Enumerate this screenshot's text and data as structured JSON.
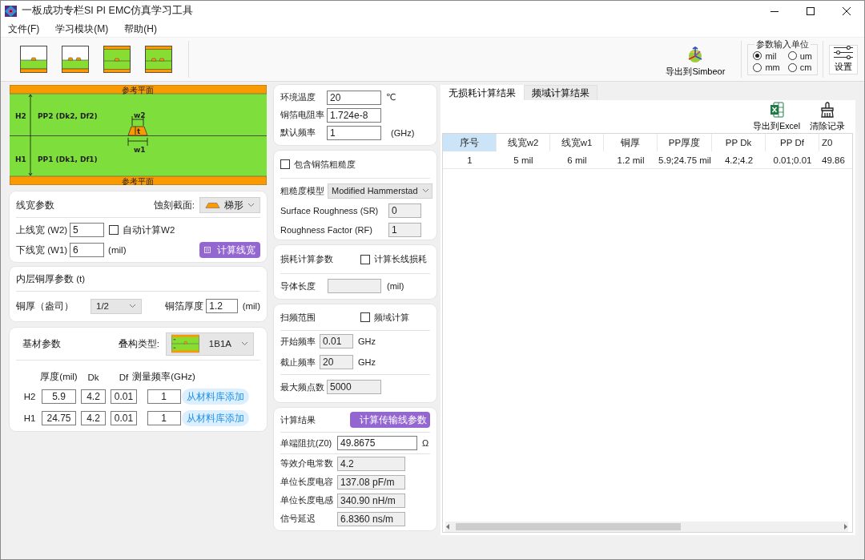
{
  "window": {
    "title": "一板成功专栏SI PI EMC仿真学习工具"
  },
  "menu": [
    "文件(F)",
    "学习模块(M)",
    "帮助(H)"
  ],
  "toolbar": {
    "stackups": [
      {
        "kind": "microstrip1"
      },
      {
        "kind": "microstrip2"
      },
      {
        "kind": "stripline1"
      },
      {
        "kind": "stripline2"
      }
    ],
    "export_simbeor": "导出到Simbeor",
    "units": {
      "title": "参数输入单位",
      "options": [
        {
          "label": "mil",
          "selected": true
        },
        {
          "label": "um",
          "selected": false
        },
        {
          "label": "mm",
          "selected": false
        },
        {
          "label": "cm",
          "selected": false
        }
      ]
    },
    "settings": "设置"
  },
  "stackup_diagram": {
    "top_plane": "参考平面",
    "bottom_plane": "参考平面",
    "h2": "H2",
    "pp2": "PP2 (Dk2, Df2)",
    "h1": "H1",
    "pp1": "PP1 (Dk1, Df1)",
    "w2": "w2",
    "t": "t",
    "w1": "w1"
  },
  "line_width": {
    "title": "线宽参数",
    "etch_label": "蚀刻截面:",
    "etch_value": "梯形",
    "w2_label": "上线宽 (W2)",
    "w2": "5",
    "auto_w2": {
      "label": "自动计算W2",
      "checked": false
    },
    "w1_label": "下线宽 (W1)",
    "w1": "6",
    "unit": "(mil)",
    "button": "计算线宽"
  },
  "copper": {
    "title": "内层铜厚参数 (t)",
    "oz_label": "铜厚（盎司）",
    "oz_value": "1/2",
    "thickness_label": "铜箔厚度",
    "thickness": "1.2",
    "unit": "(mil)"
  },
  "substrate": {
    "title": "基材参数",
    "stack_label": "叠构类型:",
    "stack_value": "1B1A",
    "columns": [
      "厚度(mil)",
      "Dk",
      "Df",
      "测量频率(GHz)"
    ],
    "rows": [
      {
        "name": "H2",
        "values": [
          "5.9",
          "4.2",
          "0.01",
          "1"
        ],
        "button": "从材料库添加"
      },
      {
        "name": "H1",
        "values": [
          "24.75",
          "4.2",
          "0.01",
          "1"
        ],
        "button": "从材料库添加"
      }
    ]
  },
  "environment": {
    "fields": [
      {
        "label": "环境温度",
        "value": "20",
        "unit": "℃"
      },
      {
        "label": "铜箔电阻率",
        "value": "1.724e-8"
      },
      {
        "label": "默认频率",
        "value": "1",
        "unit": "(GHz)"
      }
    ]
  },
  "roughness": {
    "include": {
      "label": "包含铜箔粗糙度",
      "checked": false
    },
    "model_label": "粗糙度模型",
    "model_value": "Modified Hammerstad",
    "fields": [
      {
        "label": "Surface Roughness (SR)",
        "value": "0",
        "disabled": true
      },
      {
        "label": "Roughness Factor (RF)",
        "value": "1",
        "disabled": true
      }
    ]
  },
  "loss": {
    "title": "损耗计算参数",
    "long_line": {
      "label": "计算长线损耗",
      "checked": false
    },
    "length": {
      "label": "导体长度",
      "unit": "(mil)",
      "disabled": true
    }
  },
  "sweep": {
    "title": "扫频范围",
    "freq_domain": {
      "label": "频域计算",
      "checked": false
    },
    "fields": [
      {
        "label": "开始频率",
        "value": "0.01",
        "unit": "GHz",
        "disabled": true
      },
      {
        "label": "截止频率",
        "value": "20",
        "unit": "GHz",
        "disabled": true
      },
      {
        "label": "最大频点数",
        "value": "5000",
        "disabled": true
      }
    ]
  },
  "results": {
    "title": "计算结果",
    "button": "计算传输线参数",
    "fields": [
      {
        "label": "单端阻抗(Z0)",
        "value": "49.8675",
        "unit": "Ω",
        "disabled": false
      },
      {
        "label": "等效介电常数",
        "value": "4.2",
        "disabled": true
      },
      {
        "label": "单位长度电容",
        "value": "137.08 pF/m",
        "disabled": true
      },
      {
        "label": "单位长度电感",
        "value": "340.90 nH/m",
        "disabled": true
      },
      {
        "label": "信号延迟",
        "value": "6.8360 ns/m",
        "disabled": true
      }
    ]
  },
  "tabs": [
    {
      "label": "无损耗计算结果",
      "selected": true
    },
    {
      "label": "频域计算结果",
      "selected": false
    }
  ],
  "result_actions": [
    {
      "kind": "excel",
      "label": "导出到Excel"
    },
    {
      "kind": "clear",
      "label": "清除记录"
    }
  ],
  "table": {
    "columns": [
      {
        "label": "序号",
        "selected": true
      },
      {
        "label": "线宽w2",
        "selected": false
      },
      {
        "label": "线宽w1",
        "selected": false
      },
      {
        "label": "铜厚",
        "selected": false
      },
      {
        "label": "PP厚度",
        "selected": false
      },
      {
        "label": "PP Dk",
        "selected": false
      },
      {
        "label": "PP Df",
        "selected": false
      },
      {
        "label": "Z0",
        "selected": false
      }
    ],
    "rows": [
      [
        "1",
        "5 mil",
        "6 mil",
        "1.2 mil",
        "5.9;24.75 mil",
        "4.2;4.2",
        "0.01;0.01",
        "49.86"
      ]
    ]
  }
}
